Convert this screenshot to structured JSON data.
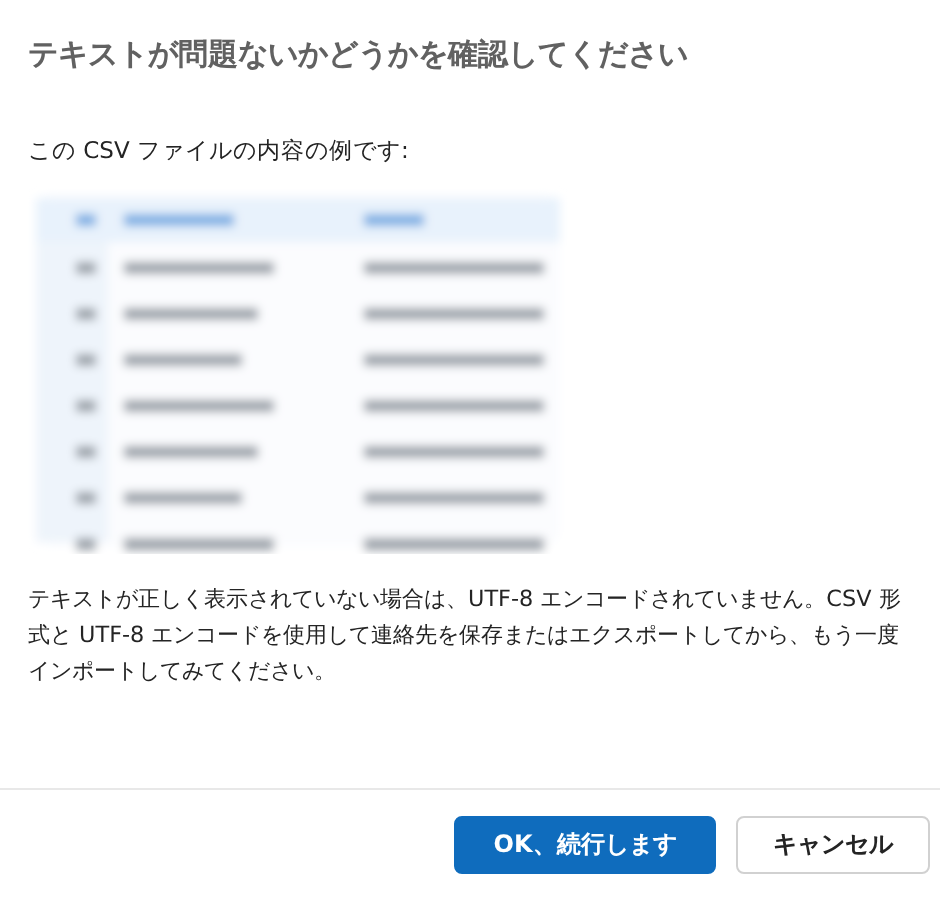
{
  "title": "テキストが問題ないかどうかを確認してください",
  "intro": "この CSV ファイルの内容の例です:",
  "message": "テキストが正しく表示されていない場合は、UTF-8 エンコードされていません。CSV 形式と UTF-8 エンコードを使用して連絡先を保存またはエクスポートしてから、もう一度インポートしてみてください。",
  "buttons": [
    {
      "label": "OK、続行します",
      "kind": "primary"
    },
    {
      "label": "キャンセル",
      "kind": "secondary"
    }
  ]
}
